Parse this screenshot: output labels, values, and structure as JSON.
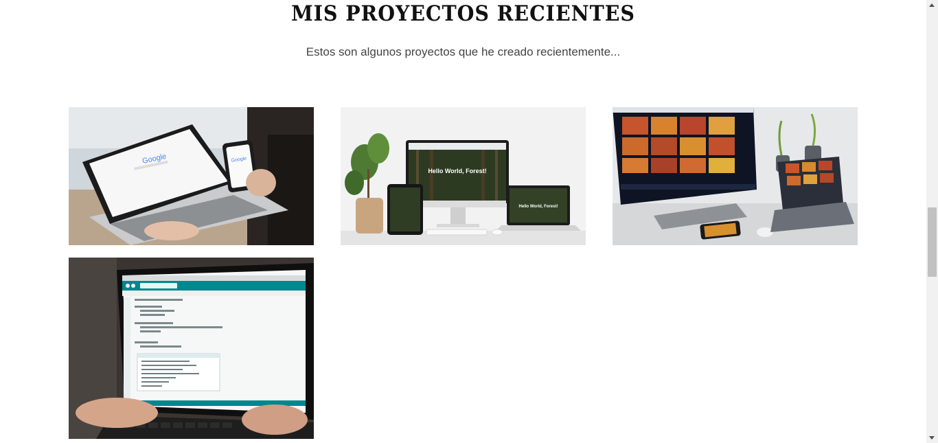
{
  "projects_section": {
    "title": "MIS PROYECTOS RECIENTES",
    "subtitle": "Estos son algunos proyectos que he creado recientemente..."
  },
  "projects": [
    {
      "screen_text": "Google"
    },
    {
      "screen_text": "Hello World, Forest!"
    },
    {
      "screen_text": ""
    },
    {
      "screen_text": ""
    }
  ],
  "colors": {
    "title": "#111111",
    "subtitle": "#444444",
    "scrollbar_track": "#f1f1f1",
    "scrollbar_thumb": "#c1c1c1"
  }
}
